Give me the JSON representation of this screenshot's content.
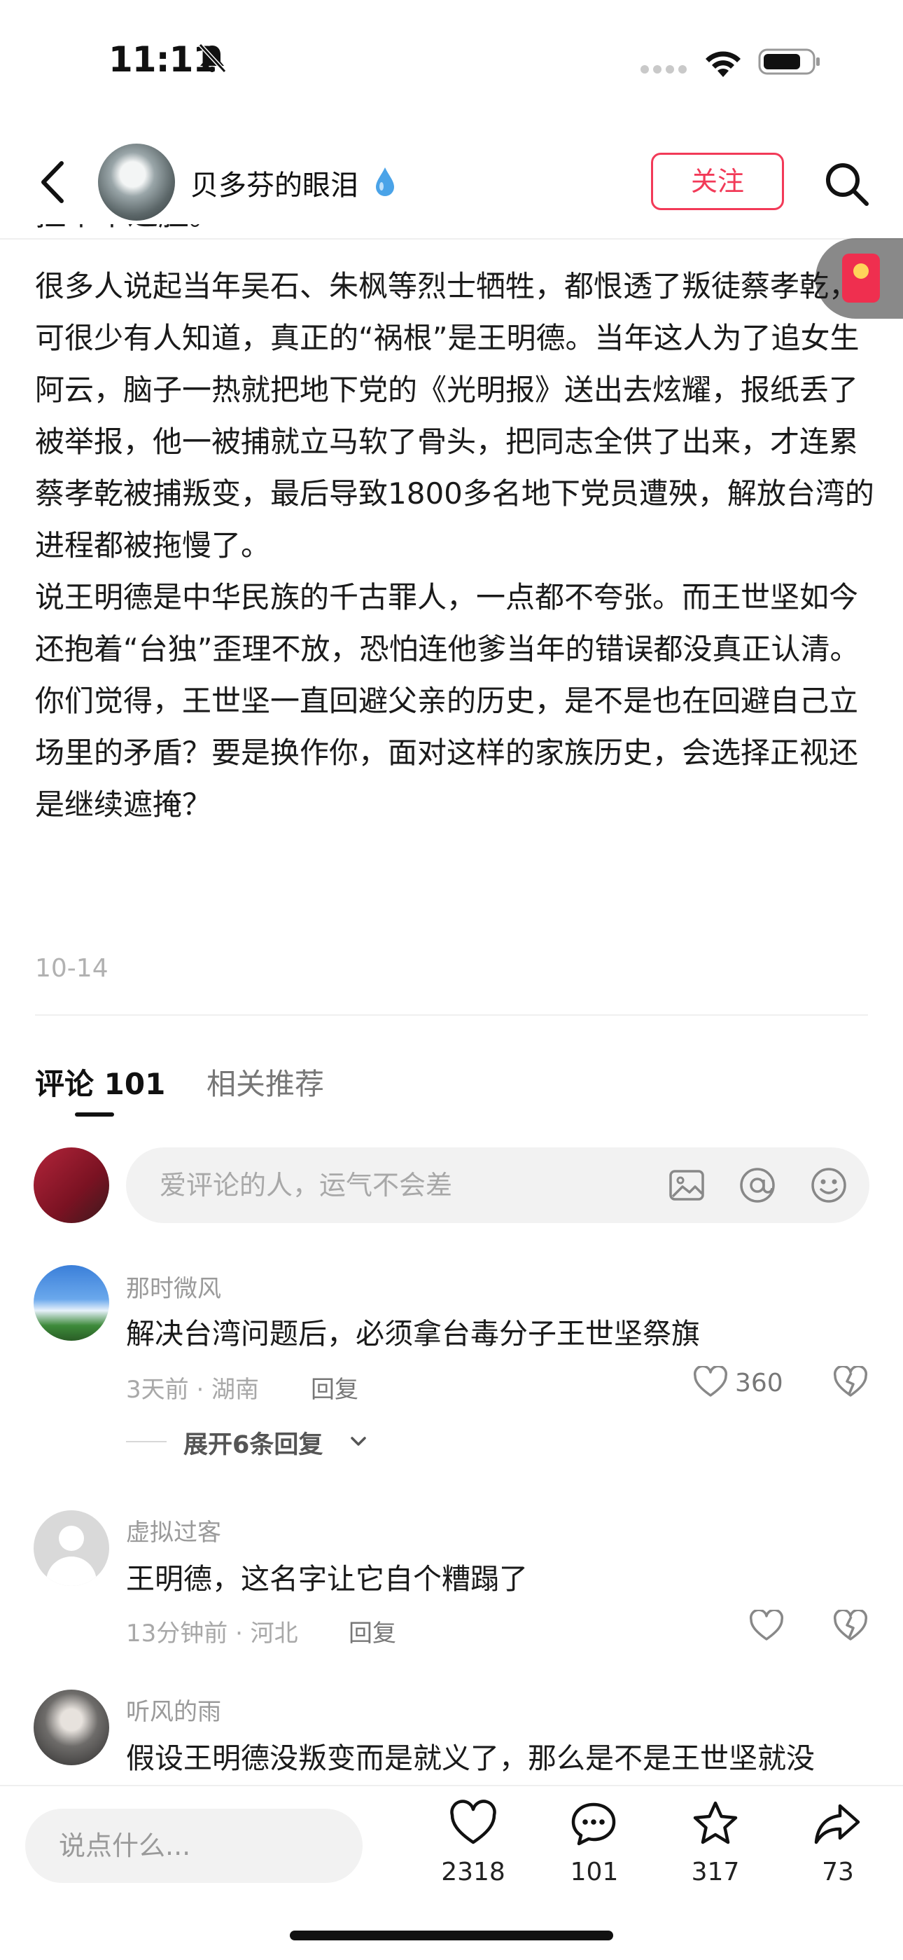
{
  "status_bar": {
    "time": "11:11"
  },
  "header": {
    "author_name": "贝多芬的眼泪",
    "follow_label": "关注"
  },
  "article": {
    "cut_line": "拉个个过脸。",
    "paragraphs": [
      "很多人说起当年吴石、朱枫等烈士牺牲，都恨透了叛徒蔡孝乾，可很少有人知道，真正的“祸根”是王明德。当年这人为了追女生阿云，脑子一热就把地下党的《光明报》送出去炫耀，报纸丢了被举报，他一被捕就立马软了骨头，把同志全供了出来，才连累蔡孝乾被捕叛变，最后导致1800多名地下党员遭殃，解放台湾的进程都被拖慢了。",
      "说王明德是中华民族的千古罪人，一点都不夸张。而王世坚如今还抱着“台独”歪理不放，恐怕连他爹当年的错误都没真正认清。",
      "你们觉得，王世坚一直回避父亲的历史，是不是也在回避自己立场里的矛盾？要是换作你，面对这样的家族历史，会选择正视还是继续遮掩？"
    ],
    "date": "10-14"
  },
  "tabs": {
    "comments": "评论 101",
    "related": "相关推荐"
  },
  "comment_input": {
    "placeholder": "爱评论的人，运气不会差"
  },
  "comments": [
    {
      "user": "那时微风",
      "text": "解决台湾问题后，必须拿台毒分子王世坚祭旗",
      "meta": "3天前 · 湖南",
      "reply": "回复",
      "likes": "360",
      "expand": "展开6条回复"
    },
    {
      "user": "虚拟过客",
      "text": "王明德，这名字让它自个糟蹋了",
      "meta": "13分钟前 · 河北",
      "reply": "回复"
    },
    {
      "user": "听风的雨",
      "text": "假设王明德没叛变而是就义了，那么是不是王世坚就没"
    }
  ],
  "bottom_bar": {
    "input_placeholder": "说点什么...",
    "likes": "2318",
    "comments": "101",
    "favorites": "317",
    "shares": "73"
  },
  "colors": {
    "accent": "#f23a58",
    "text": "#1a1a1a",
    "muted": "#a8a8a8",
    "input_bg": "#f2f2f2"
  },
  "icons": [
    "bell-muted-icon",
    "wifi-icon",
    "battery-icon",
    "back-arrow-icon",
    "water-drop-icon",
    "search-icon",
    "red-envelope-icon",
    "image-icon",
    "at-icon",
    "emoji-icon",
    "heart-icon",
    "dislike-icon",
    "chevron-down-icon",
    "comment-icon",
    "star-icon",
    "share-icon"
  ]
}
